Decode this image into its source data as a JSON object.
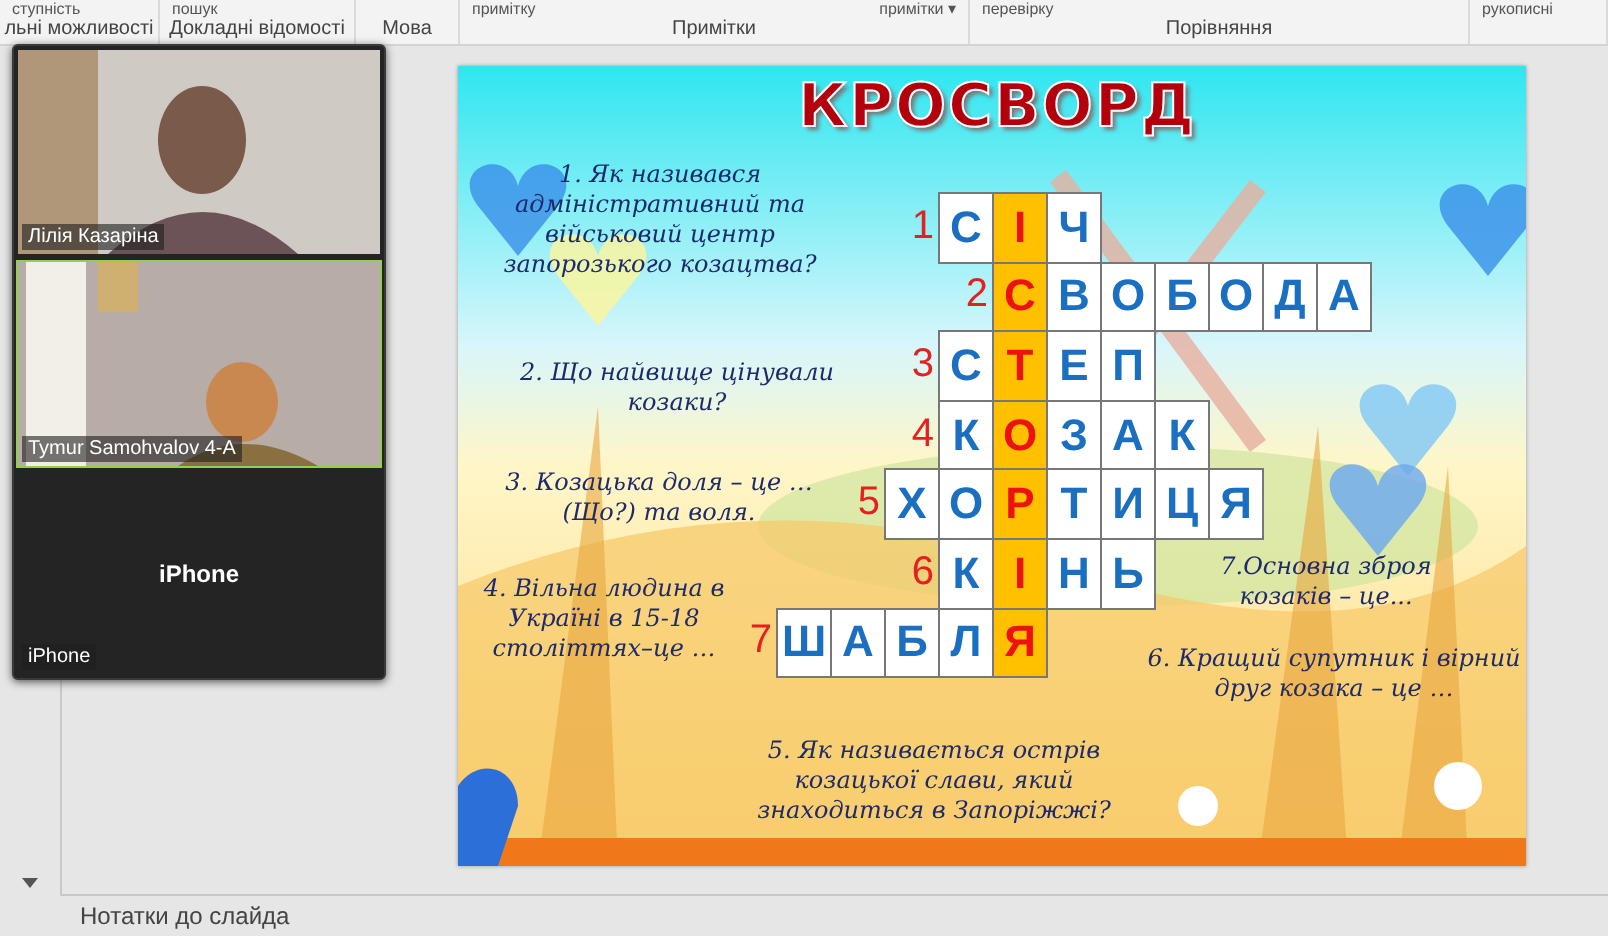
{
  "ribbon": {
    "groups": [
      {
        "top": [
          "ступність"
        ],
        "label": "льні можливості"
      },
      {
        "top": [
          "пошук"
        ],
        "label": "Докладні відомості"
      },
      {
        "label": "Мова"
      },
      {
        "top": [
          "примітку",
          "примітки ▾"
        ],
        "label": "Примітки"
      },
      {
        "top": [
          "перевірку"
        ],
        "label": "Порівняння"
      },
      {
        "top": [
          "рукописні"
        ]
      }
    ]
  },
  "video_panel": {
    "tiles": [
      {
        "kind": "video",
        "name": "Лілія Казаріна",
        "active": false
      },
      {
        "kind": "video",
        "name": "Tymur Samohvalov 4-A",
        "active": true
      },
      {
        "kind": "no_video",
        "display": "iPhone",
        "name": "iPhone",
        "active": false
      }
    ]
  },
  "slide": {
    "title": "КРОСВОРД",
    "questions": [
      {
        "text": "1. Як називався адміністративний та військовий центр запорозького козацтва?"
      },
      {
        "text": "2. Що найвище цінували козаки?"
      },
      {
        "text": "3. Козацька доля – це … (Що?) та воля."
      },
      {
        "text": "4. Вільна людина в Україні  в 15-18 століттях–це …"
      },
      {
        "text": "5. Як називається острів козацької слави, який знаходиться  в Запоріжжі?"
      },
      {
        "text": "7.Основна зброя козаків – це..."
      },
      {
        "text": "6. Кращий супутник і вірний друг козака – це …"
      }
    ],
    "crossword": {
      "rows": [
        {
          "cells": [
            {
              "kind": "blank"
            },
            {
              "kind": "blank"
            },
            {
              "kind": "blank"
            },
            {
              "kind": "number",
              "text": "1"
            },
            {
              "kind": "letter",
              "text": "С"
            },
            {
              "kind": "key",
              "text": "І"
            },
            {
              "kind": "letter",
              "text": "Ч"
            }
          ]
        },
        {
          "cells": [
            {
              "kind": "blank"
            },
            {
              "kind": "blank"
            },
            {
              "kind": "blank"
            },
            {
              "kind": "blank"
            },
            {
              "kind": "number",
              "text": "2"
            },
            {
              "kind": "key",
              "text": "С"
            },
            {
              "kind": "letter",
              "text": "В"
            },
            {
              "kind": "letter",
              "text": "О"
            },
            {
              "kind": "letter",
              "text": "Б"
            },
            {
              "kind": "letter",
              "text": "О"
            },
            {
              "kind": "letter",
              "text": "Д"
            },
            {
              "kind": "letter",
              "text": "А"
            }
          ]
        },
        {
          "cells": [
            {
              "kind": "blank"
            },
            {
              "kind": "blank"
            },
            {
              "kind": "blank"
            },
            {
              "kind": "number",
              "text": "3"
            },
            {
              "kind": "letter",
              "text": "С"
            },
            {
              "kind": "key",
              "text": "Т"
            },
            {
              "kind": "letter",
              "text": "Е"
            },
            {
              "kind": "letter",
              "text": "П"
            }
          ]
        },
        {
          "cells": [
            {
              "kind": "blank"
            },
            {
              "kind": "blank"
            },
            {
              "kind": "blank"
            },
            {
              "kind": "number",
              "text": "4"
            },
            {
              "kind": "letter",
              "text": "К"
            },
            {
              "kind": "key",
              "text": "О"
            },
            {
              "kind": "letter",
              "text": "З"
            },
            {
              "kind": "letter",
              "text": "А"
            },
            {
              "kind": "letter",
              "text": "К"
            }
          ]
        },
        {
          "cells": [
            {
              "kind": "blank"
            },
            {
              "kind": "blank"
            },
            {
              "kind": "number",
              "text": "5"
            },
            {
              "kind": "letter",
              "text": "Х"
            },
            {
              "kind": "letter",
              "text": "О"
            },
            {
              "kind": "key",
              "text": "Р"
            },
            {
              "kind": "letter",
              "text": "Т"
            },
            {
              "kind": "letter",
              "text": "И"
            },
            {
              "kind": "letter",
              "text": "Ц"
            },
            {
              "kind": "letter",
              "text": "Я"
            }
          ]
        },
        {
          "cells": [
            {
              "kind": "blank"
            },
            {
              "kind": "blank"
            },
            {
              "kind": "blank"
            },
            {
              "kind": "number",
              "text": "6"
            },
            {
              "kind": "letter",
              "text": "К"
            },
            {
              "kind": "key",
              "text": "І"
            },
            {
              "kind": "letter",
              "text": "Н"
            },
            {
              "kind": "letter",
              "text": "Ь"
            }
          ]
        },
        {
          "cells": [
            {
              "kind": "number",
              "text": "7"
            },
            {
              "kind": "letter",
              "text": "Ш"
            },
            {
              "kind": "letter",
              "text": "А"
            },
            {
              "kind": "letter",
              "text": "Б"
            },
            {
              "kind": "letter",
              "text": "Л"
            },
            {
              "kind": "key",
              "text": "Я"
            }
          ]
        }
      ]
    }
  },
  "notes_bar": {
    "label": "Нотатки до слайда"
  }
}
